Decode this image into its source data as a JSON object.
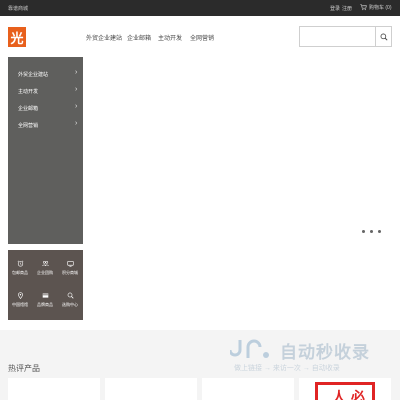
{
  "topbar": {
    "welcome": "靠谱商城",
    "login": "登录",
    "register": "注册",
    "cart": "购物车 (0)"
  },
  "header": {
    "logo_char": "光",
    "nav": [
      "外贸企业建站",
      "企业邮箱",
      "主动开发",
      "全网营销"
    ],
    "search_placeholder": ""
  },
  "sidebar": {
    "items": [
      {
        "label": "外贸企业建站",
        "arrow": "›"
      },
      {
        "label": "主动开发",
        "arrow": "›"
      },
      {
        "label": "企业邮箱",
        "arrow": "›"
      },
      {
        "label": "全网营销",
        "arrow": "›"
      }
    ]
  },
  "quick_links": [
    {
      "label": "包邮商品",
      "icon": "alarm-icon"
    },
    {
      "label": "企业团购",
      "icon": "group-icon"
    },
    {
      "label": "积分商城",
      "icon": "tv-icon"
    },
    {
      "label": "中国馆馆",
      "icon": "location-icon"
    },
    {
      "label": "品牌商品",
      "icon": "card-icon"
    },
    {
      "label": "选购中心",
      "icon": "search-icon"
    }
  ],
  "hot": {
    "title": "热评产品"
  },
  "watermark": {
    "main": "自动秒收录",
    "sub": "做上链接 → 来访一次 → 自动收录"
  },
  "badge": {
    "text": "人 必"
  },
  "colors": {
    "topbar": "#2b2b2b",
    "logo": "#e8601c",
    "sidebar": "#5f5f5d",
    "quick_panel": "#5c5450",
    "badge": "#e02424"
  }
}
